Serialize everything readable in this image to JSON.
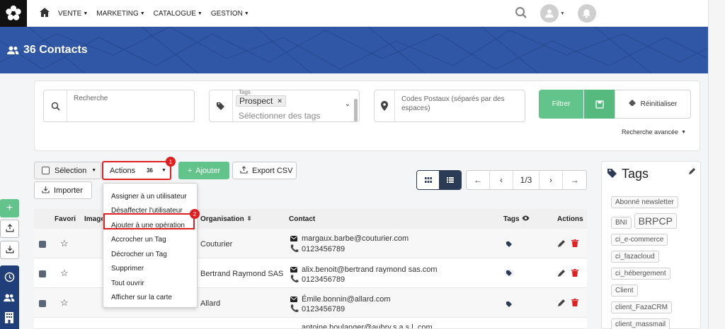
{
  "nav": {
    "items": [
      "VENTE",
      "MARKETING",
      "CATALOGUE",
      "GESTION"
    ]
  },
  "banner": {
    "title": "36 Contacts"
  },
  "search": {
    "recherche_label": "Recherche",
    "tags_label": "Tags",
    "tag_selected": "Prospect",
    "tags_placeholder": "Sélectionner des tags",
    "postal_placeholder": "Codes Postaux (séparés par des espaces)",
    "filter_label": "Filtrer",
    "reset_label": "Réinitialiser",
    "advanced_label": "Recherche avancée"
  },
  "toolbar": {
    "selection_label": "Sélection",
    "actions_label": "Actions",
    "actions_count": "36",
    "add_label": "Ajouter",
    "export_label": "Export CSV",
    "import_label": "Importer",
    "page_indicator": "1/3"
  },
  "badges": {
    "one": "1",
    "two": "2"
  },
  "menu": {
    "items": [
      "Assigner à un utilisateur",
      "Désaffecter l'utilisateur",
      "Ajouter à une opération",
      "Accrocher un Tag",
      "Décrocher un Tag",
      "Supprimer",
      "Tout ouvrir",
      "Afficher sur la carte"
    ]
  },
  "table": {
    "headers": {
      "favori": "Favori",
      "image": "Image",
      "organisation": "Organisation",
      "contact": "Contact",
      "tags": "Tags",
      "actions": "Actions"
    },
    "rows": [
      {
        "organisation": "Couturier",
        "email": "margaux.barbe@couturier.com",
        "phone": "0123456789"
      },
      {
        "organisation": "Bertrand Raymond SAS",
        "email": "alix.benoit@bertrand raymond sas.com",
        "phone": "0123456789"
      },
      {
        "organisation": "Allard",
        "email": "Émile.bonnin@allard.com",
        "phone": "0123456789"
      },
      {
        "organisation": "",
        "email": "antoine.boulanger@aubry.s.a.s.l..com",
        "phone": ""
      }
    ]
  },
  "tags_panel": {
    "title": "Tags",
    "tags": [
      "Abonné newsletter",
      "BNI",
      "BRPCP",
      "ci_e-commerce",
      "ci_fazacloud",
      "ci_hébergement",
      "Client",
      "client_FazaCRM",
      "client_massmail"
    ]
  },
  "colors": {
    "banner": "#2f57a6",
    "green": "#62c48a",
    "red": "#e02020",
    "dark": "#2b3a55"
  }
}
